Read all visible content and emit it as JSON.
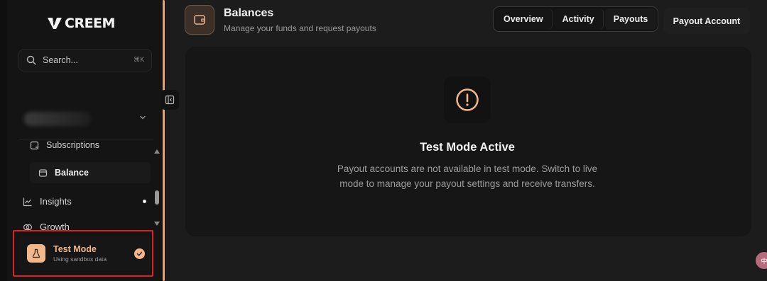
{
  "brand": {
    "name": "CREEM"
  },
  "search": {
    "placeholder": "Search...",
    "shortcut": "⌘K"
  },
  "sidebar": {
    "sub_items": [
      {
        "label": "Subscriptions",
        "icon": "subscriptions-icon"
      },
      {
        "label": "Balance",
        "icon": "balance-icon",
        "active": true
      }
    ],
    "items": [
      {
        "label": "Insights",
        "icon": "chart-icon",
        "indicator": true
      },
      {
        "label": "Growth",
        "icon": "growth-icon"
      }
    ],
    "test_mode": {
      "title": "Test Mode",
      "subtitle": "Using sandbox data",
      "enabled": true
    }
  },
  "header": {
    "title": "Balances",
    "subtitle": "Manage your funds and request payouts"
  },
  "tabs": [
    {
      "label": "Overview"
    },
    {
      "label": "Activity"
    },
    {
      "label": "Payouts"
    },
    {
      "label": "Payout Account",
      "active": true
    }
  ],
  "main": {
    "empty_title": "Test Mode Active",
    "empty_description": "Payout accounts are not available in test mode. Switch to live mode to manage your payout settings and receive transfers."
  },
  "colors": {
    "accent": "#f2b78a",
    "background": "#1c1c1c",
    "card": "#161616",
    "highlight": "#e02020"
  }
}
